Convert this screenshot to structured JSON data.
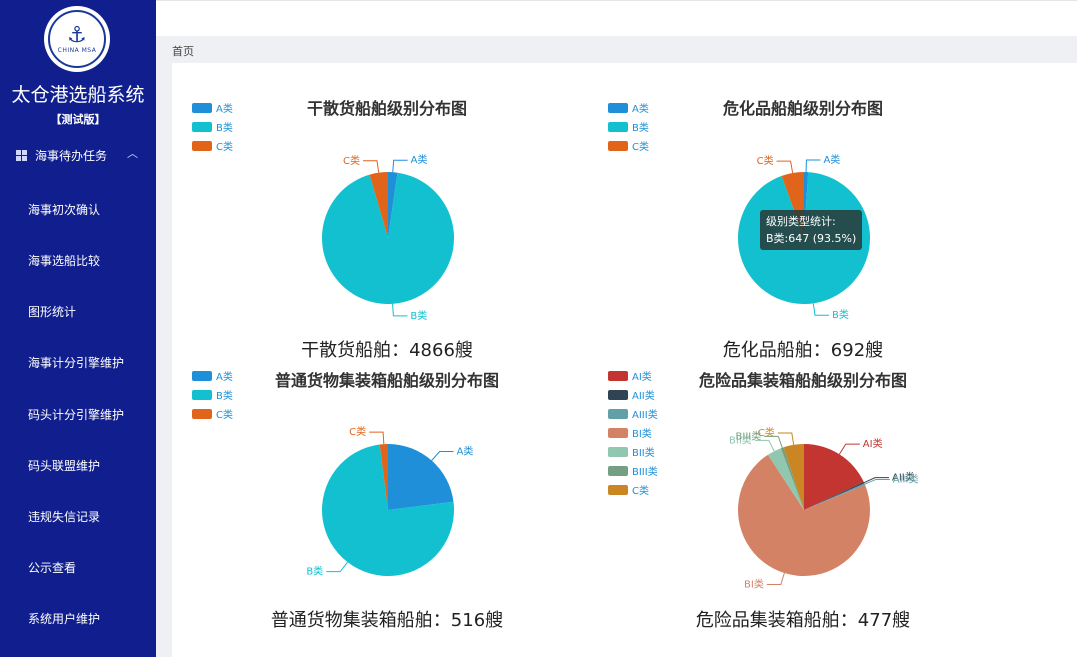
{
  "sidebar": {
    "logo_text": "CHINA MSA",
    "app_title": "太仓港选船系统",
    "app_sub": "【测试版】",
    "group_label": "海事待办任务",
    "items": [
      "海事初次确认",
      "海事选船比较",
      "图形统计",
      "海事计分引擎维护",
      "码头计分引擎维护",
      "码头联盟维护",
      "违规失信记录",
      "公示查看",
      "系统用户维护"
    ]
  },
  "breadcrumb": "首页",
  "colors": {
    "A": "#1e8fd8",
    "B": "#12c0cf",
    "C": "#e0641a",
    "AI": "#c23531",
    "AII": "#2f4554",
    "AIII": "#61a0a8",
    "BI": "#d48265",
    "BII": "#91c7ae",
    "BIII": "#749f83",
    "C2": "#ca8622"
  },
  "tooltip": {
    "title": "级别类型统计:",
    "body": "B类:647 (93.5%)"
  },
  "chart_data": [
    {
      "type": "pie",
      "title": "干散货船舶级别分布图",
      "caption": "干散货船舶：4866艘",
      "legend": [
        "A类",
        "B类",
        "C类"
      ],
      "slices": [
        {
          "name": "A类",
          "value": 2.3,
          "color": "#1e8fd8"
        },
        {
          "name": "B类",
          "value": 93.2,
          "color": "#12c0cf"
        },
        {
          "name": "C类",
          "value": 4.5,
          "color": "#e0641a"
        }
      ]
    },
    {
      "type": "pie",
      "title": "危化品船舶级别分布图",
      "caption": "危化品船舶：692艘",
      "legend": [
        "A类",
        "B类",
        "C类"
      ],
      "slices": [
        {
          "name": "A类",
          "value": 1.0,
          "color": "#1e8fd8"
        },
        {
          "name": "B类",
          "value": 93.5,
          "color": "#12c0cf"
        },
        {
          "name": "C类",
          "value": 5.5,
          "color": "#e0641a"
        }
      ]
    },
    {
      "type": "pie",
      "title": "普通货物集装箱船舶级别分布图",
      "caption": "普通货物集装箱船舶：516艘",
      "legend": [
        "A类",
        "B类",
        "C类"
      ],
      "slices": [
        {
          "name": "A类",
          "value": 23,
          "color": "#1e8fd8"
        },
        {
          "name": "B类",
          "value": 75,
          "color": "#12c0cf"
        },
        {
          "name": "C类",
          "value": 2,
          "color": "#e0641a"
        }
      ]
    },
    {
      "type": "pie",
      "title": "危险品集装箱船舶级别分布图",
      "caption": "危险品集装箱船舶：477艘",
      "legend": [
        "AI类",
        "AII类",
        "AIII类",
        "BI类",
        "BII类",
        "BIII类",
        "C类"
      ],
      "slices": [
        {
          "name": "AI类",
          "value": 18,
          "color": "#c23531"
        },
        {
          "name": "AII类",
          "value": 0.4,
          "color": "#2f4554"
        },
        {
          "name": "AIII类",
          "value": 0.4,
          "color": "#61a0a8"
        },
        {
          "name": "BI类",
          "value": 72,
          "color": "#d48265"
        },
        {
          "name": "BII类",
          "value": 3.5,
          "color": "#91c7ae"
        },
        {
          "name": "BIII类",
          "value": 0.7,
          "color": "#749f83"
        },
        {
          "name": "C类",
          "value": 5,
          "color": "#ca8622"
        }
      ]
    }
  ]
}
